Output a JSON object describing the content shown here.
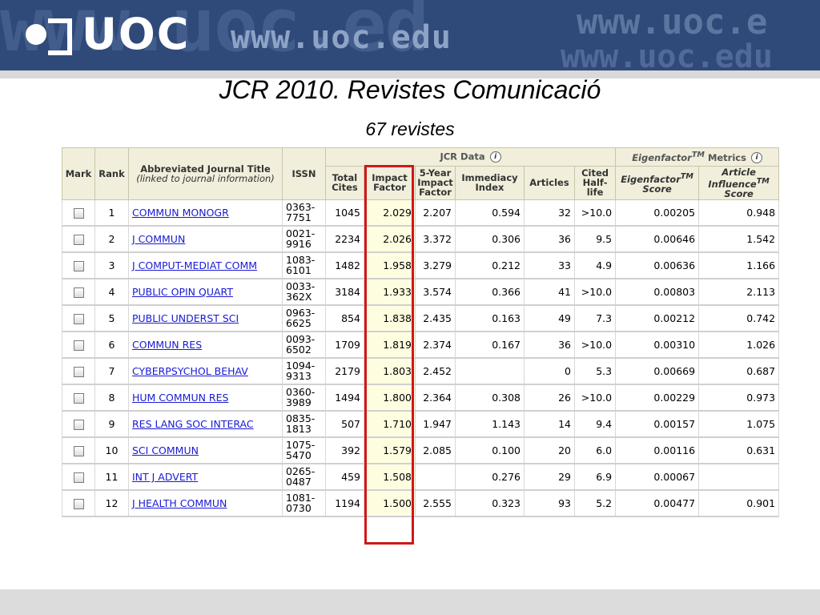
{
  "banner": {
    "logo_text": "UOC",
    "site_url": "www.uoc.edu",
    "watermark_1": "www.uoc.ed",
    "watermark_2": "www.uoc.e",
    "watermark_3": "www.uoc.edu",
    "bg_color": "#2f4a79"
  },
  "slide": {
    "title": "JCR 2010. Revistes Comunicació",
    "subtitle": "67 revistes"
  },
  "table": {
    "group_jcr": "JCR Data",
    "group_eigen": "Eigenfactor",
    "group_eigen_tm": "TM",
    "group_eigen_suffix": " Metrics",
    "info_icon": "i",
    "headers": {
      "mark": "Mark",
      "rank": "Rank",
      "title": "Abbreviated Journal Title",
      "title_sub": "(linked to journal information)",
      "issn": "ISSN",
      "total_cites": "Total Cites",
      "impact_factor": "Impact Factor",
      "five_year_if": "5-Year Impact Factor",
      "immediacy": "Immediacy Index",
      "articles": "Articles",
      "half_life": "Cited Half-life",
      "eigen_score": "Eigenfactor",
      "eigen_score_tm": "TM",
      "eigen_score_suffix": " Score",
      "ai_score": "Article Influence",
      "ai_score_tm": "TM",
      "ai_score_suffix": " Score"
    },
    "rows": [
      {
        "rank": "1",
        "title": "COMMUN MONOGR",
        "issn1": "0363-",
        "issn2": "7751",
        "cites": "1045",
        "if": "2.029",
        "if5": "2.207",
        "imm": "0.594",
        "art": "32",
        "hl": ">10.0",
        "ef": "0.00205",
        "ai": "0.948"
      },
      {
        "rank": "2",
        "title": "J COMMUN",
        "issn1": "0021-",
        "issn2": "9916",
        "cites": "2234",
        "if": "2.026",
        "if5": "3.372",
        "imm": "0.306",
        "art": "36",
        "hl": "9.5",
        "ef": "0.00646",
        "ai": "1.542"
      },
      {
        "rank": "3",
        "title": "J COMPUT-MEDIAT COMM",
        "issn1": "1083-",
        "issn2": "6101",
        "cites": "1482",
        "if": "1.958",
        "if5": "3.279",
        "imm": "0.212",
        "art": "33",
        "hl": "4.9",
        "ef": "0.00636",
        "ai": "1.166"
      },
      {
        "rank": "4",
        "title": "PUBLIC OPIN QUART",
        "issn1": "0033-",
        "issn2": "362X",
        "cites": "3184",
        "if": "1.933",
        "if5": "3.574",
        "imm": "0.366",
        "art": "41",
        "hl": ">10.0",
        "ef": "0.00803",
        "ai": "2.113"
      },
      {
        "rank": "5",
        "title": "PUBLIC UNDERST SCI",
        "issn1": "0963-",
        "issn2": "6625",
        "cites": "854",
        "if": "1.838",
        "if5": "2.435",
        "imm": "0.163",
        "art": "49",
        "hl": "7.3",
        "ef": "0.00212",
        "ai": "0.742"
      },
      {
        "rank": "6",
        "title": "COMMUN RES",
        "issn1": "0093-",
        "issn2": "6502",
        "cites": "1709",
        "if": "1.819",
        "if5": "2.374",
        "imm": "0.167",
        "art": "36",
        "hl": ">10.0",
        "ef": "0.00310",
        "ai": "1.026"
      },
      {
        "rank": "7",
        "title": "CYBERPSYCHOL BEHAV",
        "issn1": "1094-",
        "issn2": "9313",
        "cites": "2179",
        "if": "1.803",
        "if5": "2.452",
        "imm": "",
        "art": "0",
        "hl": "5.3",
        "ef": "0.00669",
        "ai": "0.687"
      },
      {
        "rank": "8",
        "title": "HUM COMMUN RES",
        "issn1": "0360-",
        "issn2": "3989",
        "cites": "1494",
        "if": "1.800",
        "if5": "2.364",
        "imm": "0.308",
        "art": "26",
        "hl": ">10.0",
        "ef": "0.00229",
        "ai": "0.973"
      },
      {
        "rank": "9",
        "title": "RES LANG SOC INTERAC",
        "issn1": "0835-",
        "issn2": "1813",
        "cites": "507",
        "if": "1.710",
        "if5": "1.947",
        "imm": "1.143",
        "art": "14",
        "hl": "9.4",
        "ef": "0.00157",
        "ai": "1.075"
      },
      {
        "rank": "10",
        "title": "SCI COMMUN",
        "issn1": "1075-",
        "issn2": "5470",
        "cites": "392",
        "if": "1.579",
        "if5": "2.085",
        "imm": "0.100",
        "art": "20",
        "hl": "6.0",
        "ef": "0.00116",
        "ai": "0.631"
      },
      {
        "rank": "11",
        "title": "INT J ADVERT",
        "issn1": "0265-",
        "issn2": "0487",
        "cites": "459",
        "if": "1.508",
        "if5": "",
        "imm": "0.276",
        "art": "29",
        "hl": "6.9",
        "ef": "0.00067",
        "ai": ""
      },
      {
        "rank": "12",
        "title": "J HEALTH COMMUN",
        "issn1": "1081-",
        "issn2": "0730",
        "cites": "1194",
        "if": "1.500",
        "if5": "2.555",
        "imm": "0.323",
        "art": "93",
        "hl": "5.2",
        "ef": "0.00477",
        "ai": "0.901"
      }
    ],
    "highlight_color": "#d01818"
  }
}
